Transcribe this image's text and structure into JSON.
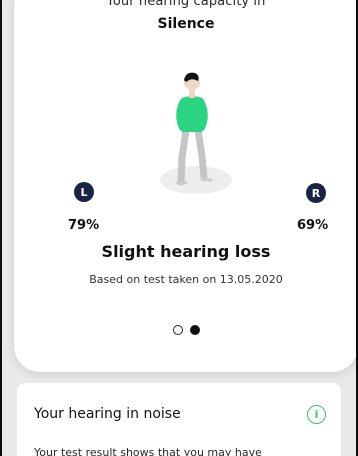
{
  "hero": {
    "subtitle": "Your hearing capacity in",
    "title": "Silence",
    "left_ear": {
      "label": "L",
      "percent": "79%",
      "value": 79
    },
    "right_ear": {
      "label": "R",
      "percent": "69%",
      "value": 69
    },
    "result": "Slight hearing loss",
    "based_on": "Based on test taken on 13.05.2020",
    "pager": {
      "total": 2,
      "active_index": 1
    }
  },
  "noise_card": {
    "title": "Your hearing in noise",
    "icon": "info-icon",
    "description": "Your test result shows that you may have"
  },
  "colors": {
    "badge": "#1c2445",
    "accent_green": "#3dbf6b",
    "shirt_green": "#2bd482",
    "background": "#e9e9e9"
  }
}
